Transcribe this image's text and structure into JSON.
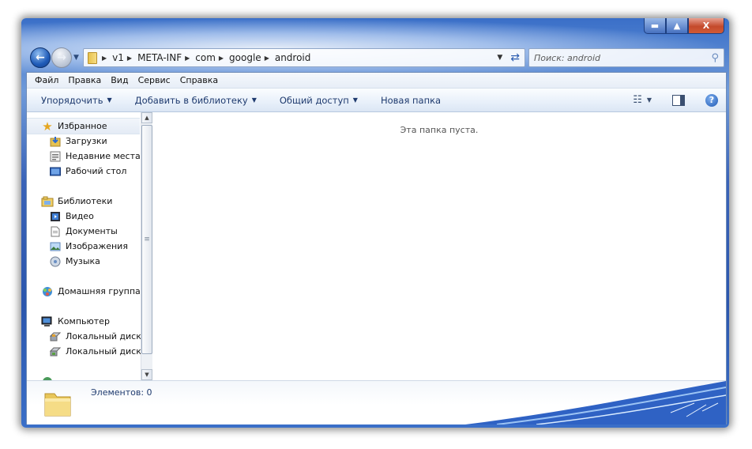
{
  "window": {
    "caption_buttons": {
      "minimize": "▬",
      "maximize": "▲",
      "close": "X"
    }
  },
  "address": {
    "crumbs": [
      "v1",
      "META-INF",
      "com",
      "google",
      "android"
    ],
    "search_placeholder": "Поиск: android"
  },
  "menu": [
    "Файл",
    "Правка",
    "Вид",
    "Сервис",
    "Справка"
  ],
  "commands": {
    "organize": "Упорядочить",
    "add_to_library": "Добавить в библиотеку",
    "share": "Общий доступ",
    "new_folder": "Новая папка"
  },
  "nav": {
    "favorites": "Избранное",
    "downloads": "Загрузки",
    "recent": "Недавние места",
    "desktop": "Рабочий стол",
    "libraries": "Библиотеки",
    "video": "Видео",
    "documents": "Документы",
    "pictures": "Изображения",
    "music": "Музыка",
    "homegroup": "Домашняя группа",
    "computer": "Компьютер",
    "disk1": "Локальный диск",
    "disk2": "Локальный диск"
  },
  "content": {
    "empty_message": "Эта папка пуста."
  },
  "details": {
    "item_count": "Элементов: 0"
  },
  "colors": {
    "accent": "#1e3a6e",
    "frame": "#3a63b8"
  }
}
